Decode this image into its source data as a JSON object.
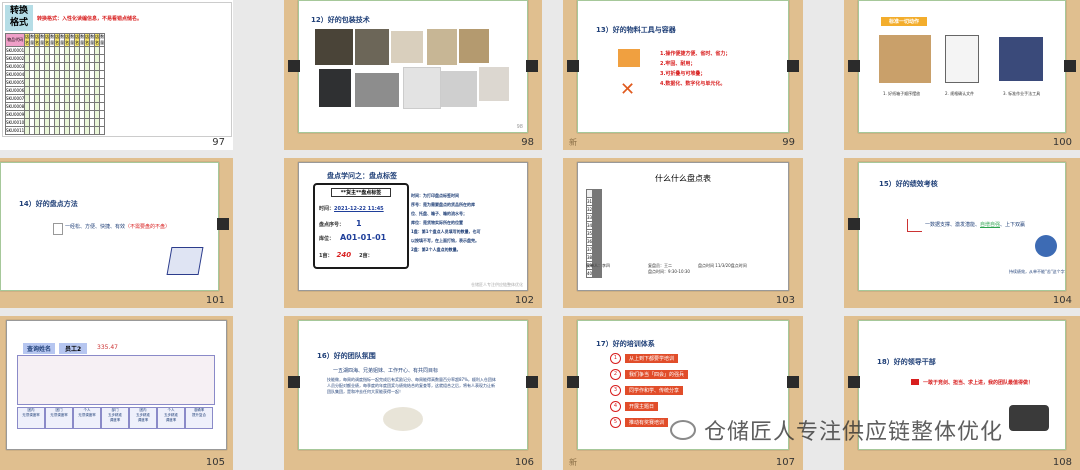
{
  "watermark": "仓储匠人专注供应链整体优化",
  "cells": [
    {
      "num": "97",
      "star": ""
    },
    {
      "num": "98",
      "star": ""
    },
    {
      "num": "99",
      "star": "新"
    },
    {
      "num": "100",
      "star": ""
    },
    {
      "num": "101",
      "star": ""
    },
    {
      "num": "102",
      "star": ""
    },
    {
      "num": "103",
      "star": ""
    },
    {
      "num": "104",
      "star": ""
    },
    {
      "num": "105",
      "star": ""
    },
    {
      "num": "106",
      "star": ""
    },
    {
      "num": "107",
      "star": "新"
    },
    {
      "num": "108",
      "star": ""
    }
  ],
  "s97": {
    "title_line1": "转换",
    "title_line2": "格式",
    "note": "转换格式：入性化读编信息，不易看错点储名。",
    "header_first": "物品代码",
    "header_pair": [
      "店名",
      "数量"
    ],
    "codes": [
      "SKU0001",
      "SKU0002",
      "SKU0003",
      "SKU0004",
      "SKU0005",
      "SKU0006",
      "SKU0007",
      "SKU0008",
      "SKU0009",
      "SKU0010",
      "SKU0011"
    ]
  },
  "s98": {
    "title": "12）好的包装技术"
  },
  "s99": {
    "title": "13）好的物料工具与容器",
    "items": [
      "1.操作便捷方便、省时、省力；",
      "2.牢固、耐用；",
      "3.可折叠与可堆叠；",
      "4.数据化、数字化与单元化。"
    ]
  },
  "s100": {
    "banner": "标准一切动作",
    "captions": [
      "1. 好纸箱子顺序摆放",
      "2. 规格确认文件",
      "3. 标准作业手法工具"
    ]
  },
  "s101": {
    "title": "14）好的盘点方法",
    "text": "一经松、方便、快捷、有效",
    "text_red": "（不需要盘的不盘）"
  },
  "s102": {
    "heading": "盘点学问之：盘点标签",
    "label_title": "**货主**盘点标签",
    "time_label": "时间：",
    "time_value": "2021-12-22  11:45",
    "seq_label": "盘点序号：",
    "seq_value": "1",
    "loc_label": "库位：",
    "loc_value": "A01-01-01",
    "first_label": "1亩：",
    "first_value": "240",
    "second_label": "2亩：",
    "notes": [
      "时间：为打印盘点标签时间",
      "序号：是为需要盘点的货品所在的库",
      "位、托盘、箱子、箱的流水号；",
      "库位：是货物实际所在的位置",
      "1盘：第1个盘点人员填写的数量，也可",
      "以按填不写，在上面打钩，表示盘完。",
      "2盘：第2个人盘点的数量。"
    ],
    "footer": "仓储匠人专注供应链整体优化"
  },
  "s103": {
    "title": "什么什么盘点表",
    "row_labels": [
      "31",
      "32",
      "33",
      "34",
      "35",
      "36",
      "37",
      "38",
      "39",
      "40"
    ],
    "footer_left": "制单人：李四",
    "footer_mid": "复盘员：王二",
    "footer_right": "盘点时间 11/3/20盘点时间",
    "footer_note": "盘点时间：9:30-10:30"
  },
  "s104": {
    "title": "15）好的绩效考核",
    "text": "一数据支撑、激发潜能、",
    "text_green": "自增自强",
    "text_tail": "、上下双赢",
    "caption": "持续绩效，从单不能\"苦\"这个字"
  },
  "s105": {
    "label": "查询姓名",
    "name": "员工2",
    "score": "335.47",
    "footer_cols": [
      "团内\n无须调度率",
      "团门\n无须调度率",
      "个人\n无须调度率",
      "部门\n五步精准\n调度率",
      "团内\n五步精准\n调度率",
      "个人\n五步精准\n调度率",
      "准确率\n提升复合"
    ]
  },
  "s106": {
    "title": "16）好的团队氛围",
    "text": "一五湖四海、兄弟姐妹、工作开心、有共同目标",
    "para": "技能做，每周的调度指标一起完成后有奖励记分、每周能得高数量百分率超87%，顺利入仓团体人员分配对额业绩，每季度的年度团奖与绩效结合的复查等，这就组合之后，将有人表现力让新团队集团，是和冲去任何大家能获得一起！"
  },
  "s107": {
    "title": "17）好的培训体系",
    "items": [
      "从上到下都要学培训",
      "我们争当「四会」的强兵",
      "同学作和学、传统分享",
      "开展主题日",
      "推动有奖赛培训"
    ]
  },
  "s108": {
    "title": "18）好的领导干部",
    "text": "一敢于竞剑、担当、求上进，我的团队最值得做！"
  }
}
